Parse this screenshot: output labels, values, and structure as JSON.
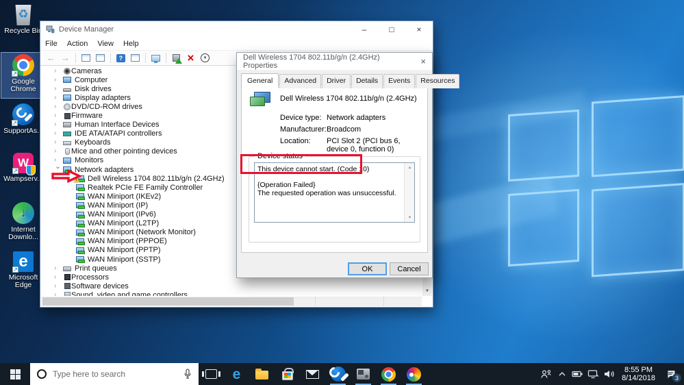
{
  "icons": {
    "chevron_collapsed": "›",
    "chevron_expanded": "›",
    "minimize": "–",
    "maximize": "□",
    "close": "×",
    "scroll_up": "▲",
    "scroll_down": "▼"
  },
  "colors": {
    "annotation_red": "#e8112d",
    "taskbar_active_underline": "#76b9ed",
    "desktop_bright_blue": "#1878c4"
  },
  "desktop": {
    "icons": [
      {
        "label": "Recycle Bin",
        "icon": "recycle",
        "selected": false,
        "shortcut": false
      },
      {
        "label": "Google Chrome",
        "icon": "chrome",
        "selected": true,
        "shortcut": true
      },
      {
        "label": "SupportAs...",
        "icon": "support",
        "selected": false,
        "shortcut": true
      },
      {
        "label": "Wampserv...",
        "icon": "wamp",
        "selected": false,
        "shortcut": true
      },
      {
        "label": "Internet Downlo...",
        "icon": "idm",
        "selected": false,
        "shortcut": false
      },
      {
        "label": "Microsoft Edge",
        "icon": "edge",
        "selected": false,
        "shortcut": true
      }
    ]
  },
  "device_manager": {
    "title": "Device Manager",
    "menu": [
      "File",
      "Action",
      "View",
      "Help"
    ],
    "toolbar": [
      "back",
      "forward",
      "sep",
      "console",
      "list",
      "sep",
      "help",
      "window",
      "sep",
      "scan",
      "sep",
      "update",
      "uninstall",
      "disable"
    ],
    "tree": [
      {
        "label": "Cameras",
        "icon": "camera",
        "level": 1,
        "state": "collapsed"
      },
      {
        "label": "Computer",
        "icon": "screen",
        "level": 1,
        "state": "collapsed"
      },
      {
        "label": "Disk drives",
        "icon": "disk",
        "level": 1,
        "state": "collapsed"
      },
      {
        "label": "Display adapters",
        "icon": "screen",
        "level": 1,
        "state": "collapsed"
      },
      {
        "label": "DVD/CD-ROM drives",
        "icon": "dvd",
        "level": 1,
        "state": "collapsed"
      },
      {
        "label": "Firmware",
        "icon": "firmware",
        "level": 1,
        "state": "collapsed"
      },
      {
        "label": "Human Interface Devices",
        "icon": "hid",
        "level": 1,
        "state": "collapsed"
      },
      {
        "label": "IDE ATA/ATAPI controllers",
        "icon": "ide",
        "level": 1,
        "state": "collapsed"
      },
      {
        "label": "Keyboards",
        "icon": "keyboard",
        "level": 1,
        "state": "collapsed"
      },
      {
        "label": "Mice and other pointing devices",
        "icon": "mouse",
        "level": 1,
        "state": "collapsed"
      },
      {
        "label": "Monitors",
        "icon": "screen",
        "level": 1,
        "state": "collapsed"
      },
      {
        "label": "Network adapters",
        "icon": "net",
        "level": 1,
        "state": "expanded"
      },
      {
        "label": "Dell Wireless 1704 802.11b/g/n (2.4GHz)",
        "icon": "net",
        "level": 2,
        "warning": true
      },
      {
        "label": "Realtek PCIe FE Family Controller",
        "icon": "net",
        "level": 2
      },
      {
        "label": "WAN Miniport (IKEv2)",
        "icon": "net",
        "level": 2
      },
      {
        "label": "WAN Miniport (IP)",
        "icon": "net",
        "level": 2
      },
      {
        "label": "WAN Miniport (IPv6)",
        "icon": "net",
        "level": 2
      },
      {
        "label": "WAN Miniport (L2TP)",
        "icon": "net",
        "level": 2
      },
      {
        "label": "WAN Miniport (Network Monitor)",
        "icon": "net",
        "level": 2
      },
      {
        "label": "WAN Miniport (PPPOE)",
        "icon": "net",
        "level": 2
      },
      {
        "label": "WAN Miniport (PPTP)",
        "icon": "net",
        "level": 2
      },
      {
        "label": "WAN Miniport (SSTP)",
        "icon": "net",
        "level": 2
      },
      {
        "label": "Print queues",
        "icon": "print",
        "level": 1,
        "state": "collapsed"
      },
      {
        "label": "Processors",
        "icon": "processor",
        "level": 1,
        "state": "collapsed"
      },
      {
        "label": "Software devices",
        "icon": "software",
        "level": 1,
        "state": "collapsed"
      },
      {
        "label": "Sound, video and game controllers",
        "icon": "sound",
        "level": 1,
        "state": "collapsed"
      }
    ]
  },
  "dialog": {
    "title": "Dell Wireless 1704 802.11b/g/n (2.4GHz) Properties",
    "tabs": [
      "General",
      "Advanced",
      "Driver",
      "Details",
      "Events",
      "Resources"
    ],
    "active_tab": "General",
    "device_name": "Dell Wireless 1704 802.11b/g/n (2.4GHz)",
    "fields": [
      {
        "label": "Device type:",
        "value": "Network adapters"
      },
      {
        "label": "Manufacturer:",
        "value": "Broadcom"
      },
      {
        "label": "Location:",
        "value": "PCI Slot 2 (PCI bus 6, device 0, function 0)"
      }
    ],
    "status_label": "Device status",
    "status_lines": [
      "This device cannot start. (Code 10)",
      "{Operation Failed}",
      "The requested operation was unsuccessful."
    ],
    "ok_label": "OK",
    "cancel_label": "Cancel"
  },
  "taskbar": {
    "search_placeholder": "Type here to search",
    "apps": [
      {
        "name": "task-view",
        "active": false
      },
      {
        "name": "edge",
        "active": false
      },
      {
        "name": "file-explorer",
        "active": false
      },
      {
        "name": "store",
        "active": false
      },
      {
        "name": "mail",
        "active": false
      },
      {
        "name": "supportassist",
        "active": true
      },
      {
        "name": "device-manager",
        "active": true
      },
      {
        "name": "chrome",
        "active": true
      },
      {
        "name": "paint",
        "active": true
      }
    ],
    "tray": {
      "time": "8:55 PM",
      "date": "8/14/2018",
      "notification_count": "3"
    }
  }
}
